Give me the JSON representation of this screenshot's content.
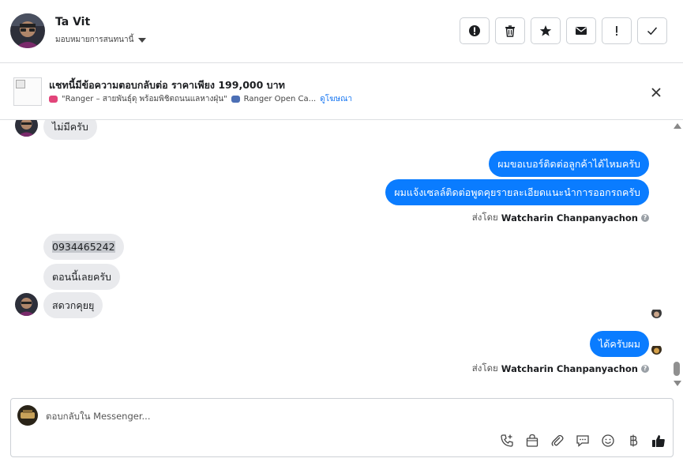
{
  "header": {
    "contact_name": "Ta Vit",
    "assign_label": "มอบหมายการสนทนานี้",
    "actions": [
      {
        "icon": "alert-circle-icon",
        "label": "Mark as spam"
      },
      {
        "icon": "trash-icon",
        "label": "Delete"
      },
      {
        "icon": "star-icon",
        "label": "Star"
      },
      {
        "icon": "envelope-icon",
        "label": "Mark as unread"
      },
      {
        "icon": "exclamation-icon",
        "label": "Follow up"
      },
      {
        "icon": "checkmark-icon",
        "label": "Mark as done"
      }
    ]
  },
  "ad_banner": {
    "title": "แชทนี้มีข้อความตอบกลับต่อ ราคาเพียง 199,000 บาท",
    "subtitle_part1": "\"Ranger – สายพันธุ์ดุ พร้อมพิชิตถนนแลหางฝุ่น\"",
    "subtitle_part2": "Ranger Open Ca...",
    "link_label": "ดูโฆษณา"
  },
  "messages": [
    {
      "side": "in",
      "text": "ไม่มีครับ"
    },
    {
      "side": "out",
      "text": "ผมขอเบอร์ติดต่อลูกค้าได้ไหมครับ"
    },
    {
      "side": "out",
      "text": "ผมแจ้งเซลล์ติดต่อพูดคุยรายละเอียดแนะนำการออกรถครับ"
    },
    {
      "side": "in",
      "text": "0934465242"
    },
    {
      "side": "in",
      "text": "ตอนนี้เลยครับ"
    },
    {
      "side": "in",
      "text": "สดวกคุยยุ"
    },
    {
      "side": "out",
      "text": "ได้ครับผม"
    }
  ],
  "sent_by": {
    "prefix": "ส่งโดย",
    "agent_name": "Watcharin Chanpanyachon"
  },
  "composer": {
    "placeholder": "ตอบกลับใน Messenger...",
    "tools": [
      "phone-plus-icon",
      "shopping-bag-icon",
      "paperclip-icon",
      "chat-bubble-icon",
      "smiley-icon",
      "baht-icon",
      "thumbs-up-icon"
    ]
  },
  "colors": {
    "outgoing_bubble": "#0a7cff",
    "incoming_bubble": "#e9eaed",
    "link": "#1877f2"
  }
}
